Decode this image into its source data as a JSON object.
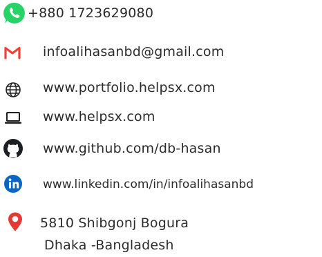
{
  "contacts": {
    "phone": {
      "icon": "whatsapp-icon",
      "text": "+880 1723629080"
    },
    "email": {
      "icon": "gmail-icon",
      "text": "infoalihasanbd@gmail.com"
    },
    "portfolio": {
      "icon": "globe-icon",
      "text": "www.portfolio.helpsx.com"
    },
    "website": {
      "icon": "laptop-icon",
      "text": "www.helpsx.com"
    },
    "github": {
      "icon": "github-icon",
      "text": "www.github.com/db-hasan"
    },
    "linkedin": {
      "icon": "linkedin-icon",
      "text": "www.linkedin.com/in/infoalihasanbd"
    },
    "address": {
      "icon": "location-pin-icon",
      "line1": "5810 Shibgonj Bogura",
      "line2": "Dhaka -Bangladesh"
    }
  },
  "colors": {
    "text": "#2b2b2b",
    "whatsapp": "#25d366",
    "gmail": "#ea4335",
    "linkedin": "#0a66c2",
    "location": "#e53935"
  }
}
